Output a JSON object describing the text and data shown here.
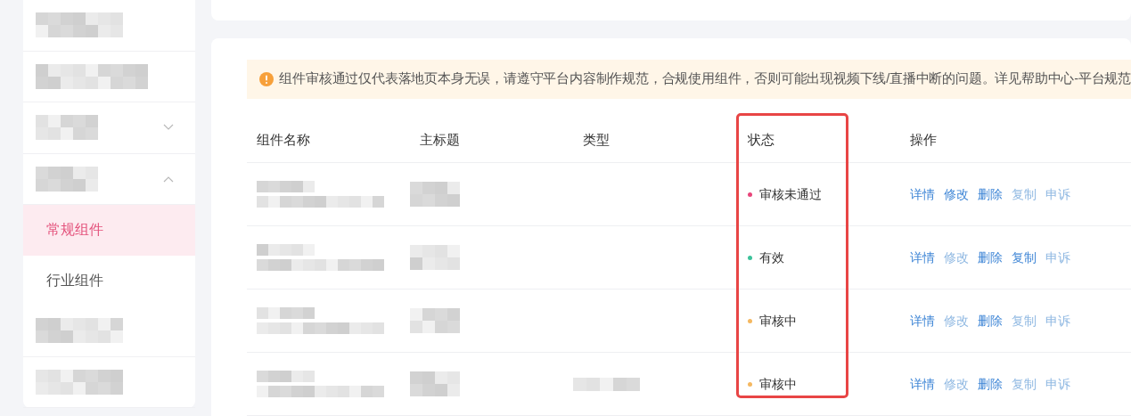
{
  "sidebar": {
    "items": [
      {
        "kind": "redacted"
      },
      {
        "kind": "redacted"
      },
      {
        "kind": "group",
        "expanded": false
      },
      {
        "kind": "group",
        "expanded": true
      },
      {
        "kind": "item",
        "label": "常规组件",
        "selected": true
      },
      {
        "kind": "item",
        "label": "行业组件",
        "selected": false
      },
      {
        "kind": "redacted"
      },
      {
        "kind": "redacted"
      }
    ]
  },
  "notice": {
    "text": "组件审核通过仅代表落地页本身无误，请遵守平台内容制作规范，合规使用组件，否则可能出现视频下线/直播中断的问题。详见帮助中心-平台规范"
  },
  "table": {
    "columns": [
      "组件名称",
      "主标题",
      "类型",
      "状态",
      "操作"
    ],
    "rows": [
      {
        "status": "审核未通过",
        "color": "#e8457a",
        "actions": [
          {
            "label": "详情",
            "disabled": false
          },
          {
            "label": "修改",
            "disabled": false
          },
          {
            "label": "删除",
            "disabled": false
          },
          {
            "label": "复制",
            "disabled": true
          },
          {
            "label": "申诉",
            "disabled": true
          }
        ]
      },
      {
        "status": "有效",
        "color": "#3cc29a",
        "actions": [
          {
            "label": "详情",
            "disabled": false
          },
          {
            "label": "修改",
            "disabled": true
          },
          {
            "label": "删除",
            "disabled": false
          },
          {
            "label": "复制",
            "disabled": false
          },
          {
            "label": "申诉",
            "disabled": true
          }
        ]
      },
      {
        "status": "审核中",
        "color": "#f5b860",
        "actions": [
          {
            "label": "详情",
            "disabled": false
          },
          {
            "label": "修改",
            "disabled": true
          },
          {
            "label": "删除",
            "disabled": false
          },
          {
            "label": "复制",
            "disabled": true
          },
          {
            "label": "申诉",
            "disabled": true
          }
        ]
      },
      {
        "status": "审核中",
        "color": "#f5b860",
        "actions": [
          {
            "label": "详情",
            "disabled": false
          },
          {
            "label": "修改",
            "disabled": true
          },
          {
            "label": "删除",
            "disabled": false
          },
          {
            "label": "复制",
            "disabled": true
          },
          {
            "label": "申诉",
            "disabled": true
          }
        ]
      }
    ]
  }
}
